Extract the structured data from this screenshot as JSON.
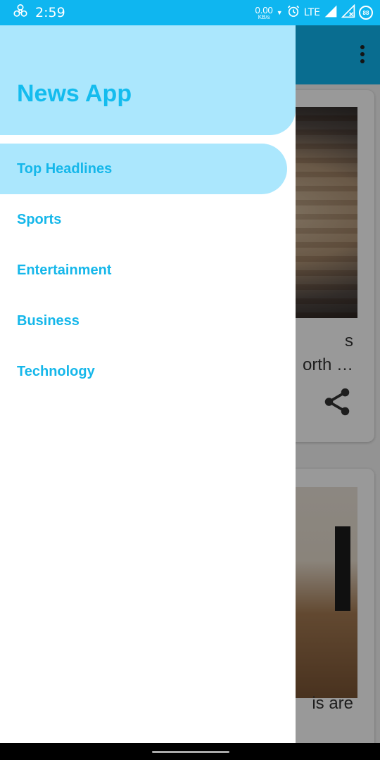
{
  "status_bar": {
    "time": "2:59",
    "net_speed_value": "0.00",
    "net_speed_unit": "KB/s",
    "network_type": "LTE",
    "battery_level": "88",
    "icons": [
      "biohazard-icon",
      "alarm-icon",
      "signal-icon",
      "signal-x-icon",
      "battery-circle-icon"
    ]
  },
  "drawer": {
    "title": "News App",
    "items": [
      {
        "label": "Top Headlines",
        "active": true
      },
      {
        "label": "Sports",
        "active": false
      },
      {
        "label": "Entertainment",
        "active": false
      },
      {
        "label": "Business",
        "active": false
      },
      {
        "label": "Technology",
        "active": false
      }
    ]
  },
  "background": {
    "card1_title_line1": "s",
    "card1_title_line2": "orth …",
    "card2_caption": "is are"
  },
  "colors": {
    "accent": "#0fb6f0",
    "drawer_header": "#abe7fd",
    "nav_text": "#15b7ea"
  }
}
